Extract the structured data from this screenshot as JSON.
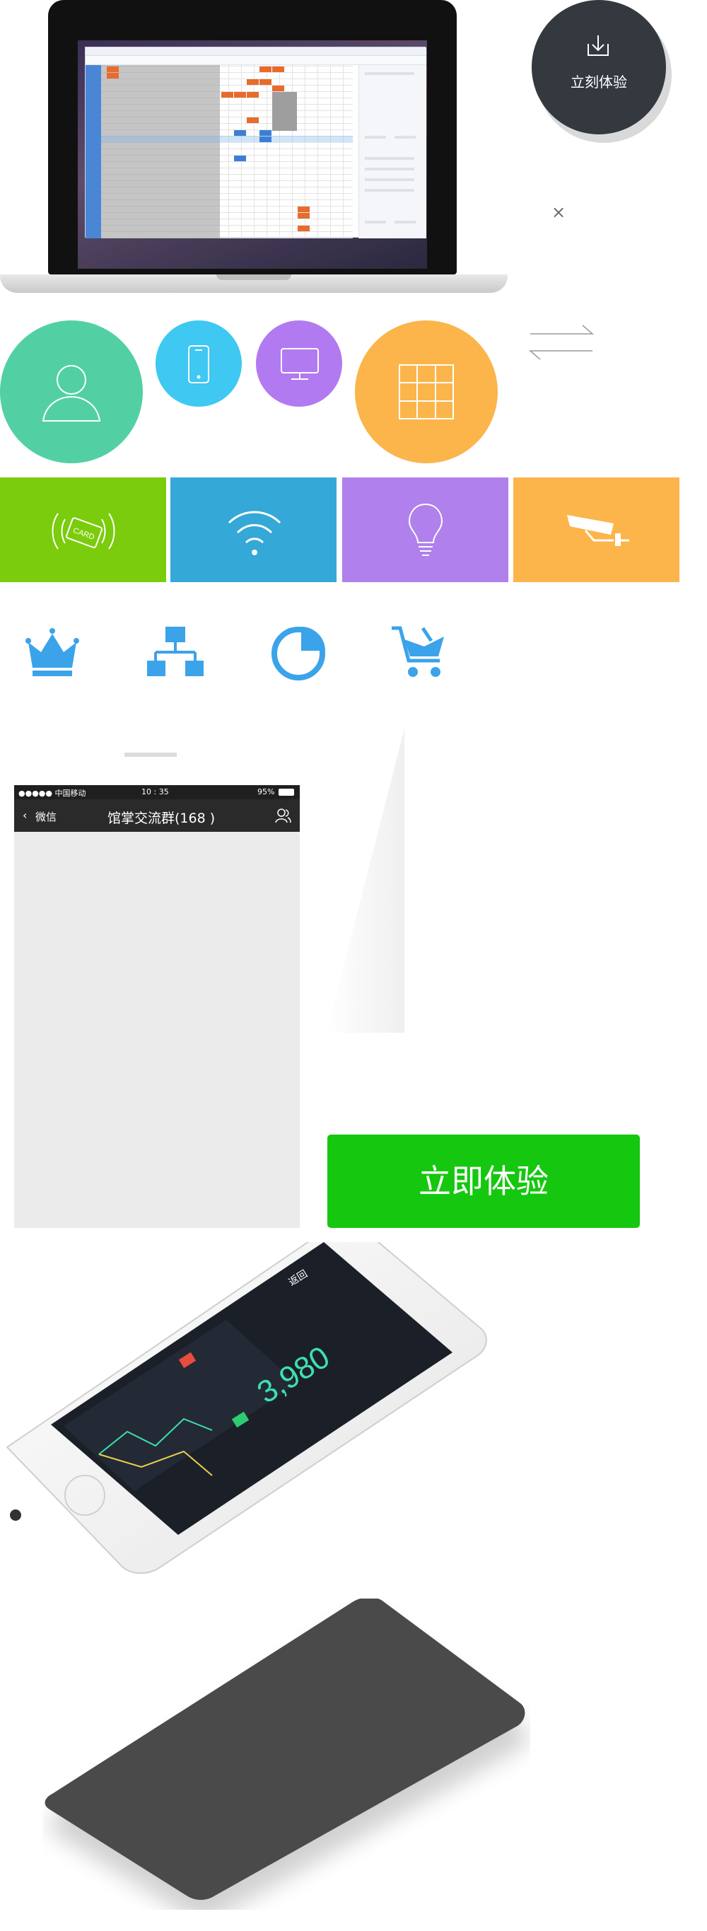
{
  "download": {
    "label": "立刻体验",
    "icon": "download-icon"
  },
  "close": {
    "label": "×"
  },
  "chat": {
    "status_carrier": "●●●●● 中国移动",
    "status_time": "10 : 35",
    "status_battery": "95%",
    "back_label": "微信",
    "title": "馆掌交流群(168 )"
  },
  "cta": {
    "label": "立即体验"
  },
  "icons": {
    "circles": [
      "user-icon",
      "phone-icon",
      "monitor-icon",
      "grid-icon"
    ],
    "tiles": [
      "card-reader-icon",
      "wifi-icon",
      "bulb-icon",
      "camera-icon"
    ],
    "blue": [
      "crown-icon",
      "org-chart-icon",
      "pie-chart-icon",
      "cart-icon"
    ],
    "card_text": "CARD"
  },
  "colors": {
    "user": "#52d0a4",
    "phone": "#3ec8f2",
    "monitor": "#b27af0",
    "grid": "#fbb54b",
    "card": "#7acc0c",
    "wifi": "#34a8d6",
    "bulb": "#b080ec",
    "camera": "#fbb54b",
    "blue_icon": "#3ba3ea",
    "cta": "#16c70f",
    "download": "#34383f"
  },
  "iphone_app": {
    "back": "返回",
    "big_number": "3,980"
  }
}
